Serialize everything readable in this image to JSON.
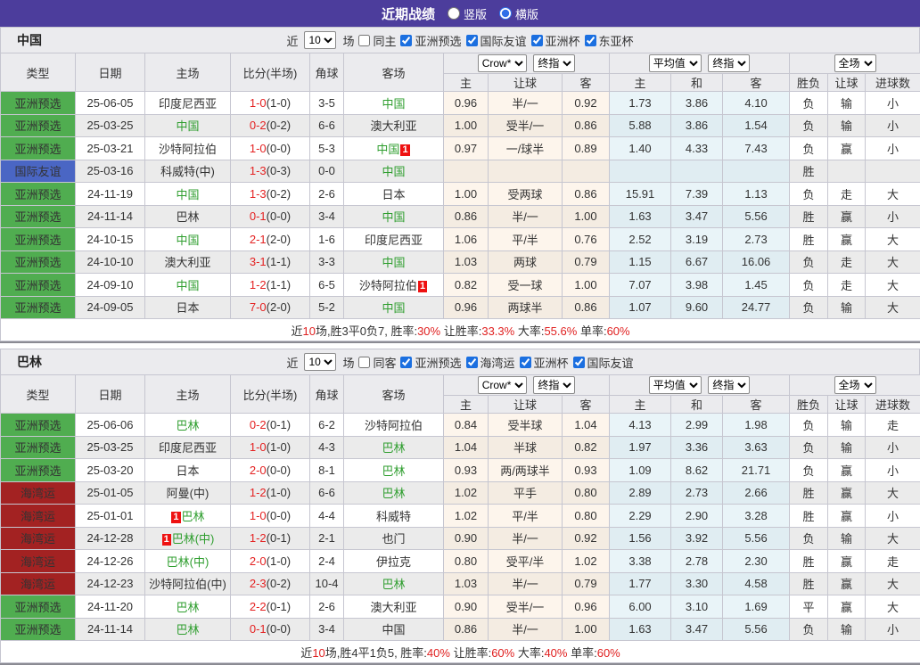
{
  "topbar": {
    "title": "近期战绩",
    "radio_vertical": "竖版",
    "radio_horizontal": "横版",
    "accent_color": "#4c3d9c"
  },
  "headers": {
    "cols": [
      "类型",
      "日期",
      "主场",
      "比分(半场)",
      "角球",
      "客场"
    ],
    "dd": [
      "Crow*",
      "终指",
      "平均值",
      "终指",
      "全场"
    ],
    "sub": [
      "主",
      "让球",
      "客",
      "主",
      "和",
      "客",
      "胜负",
      "让球",
      "进球数"
    ]
  },
  "status_colors": {
    "win": "#e03333",
    "lose": "#2626d9",
    "draw_or_push": "#2e8b2e",
    "type_green": "#50ad50",
    "type_blue": "#4a66c4",
    "type_red": "#a32222",
    "team_highlight": "#2f9e2f",
    "score_red": "#e42222"
  },
  "tables": [
    {
      "team": "中国",
      "filter": {
        "near": "近",
        "count": "10",
        "games": "场",
        "same": "同主",
        "same_checked": false,
        "comps": [
          "亚洲预选",
          "国际友谊",
          "亚洲杯",
          "东亚杯"
        ],
        "comps_checked": [
          true,
          true,
          true,
          true
        ]
      },
      "rows": [
        {
          "type": "亚洲预选",
          "tc": "g",
          "date": "25-06-05",
          "home": "印度尼西亚",
          "hhl": false,
          "hbadge": "",
          "hbpos": "",
          "ft": "1-0",
          "ht": "(1-0)",
          "cor": "3-5",
          "away": "中国",
          "ahl": true,
          "abadge": "",
          "o": [
            "0.96",
            "半/一",
            "0.92"
          ],
          "a": [
            "1.73",
            "3.86",
            "4.10"
          ],
          "r": [
            "负",
            "输",
            "小"
          ]
        },
        {
          "type": "亚洲预选",
          "tc": "g",
          "date": "25-03-25",
          "home": "中国",
          "hhl": true,
          "hbadge": "",
          "hbpos": "",
          "ft": "0-2",
          "ht": "(0-2)",
          "cor": "6-6",
          "away": "澳大利亚",
          "ahl": false,
          "abadge": "",
          "o": [
            "1.00",
            "受半/一",
            "0.86"
          ],
          "a": [
            "5.88",
            "3.86",
            "1.54"
          ],
          "r": [
            "负",
            "输",
            "小"
          ]
        },
        {
          "type": "亚洲预选",
          "tc": "g",
          "date": "25-03-21",
          "home": "沙特阿拉伯",
          "hhl": false,
          "hbadge": "",
          "hbpos": "",
          "ft": "1-0",
          "ht": "(0-0)",
          "cor": "5-3",
          "away": "中国",
          "ahl": true,
          "abadge": "1",
          "o": [
            "0.97",
            "一/球半",
            "0.89"
          ],
          "a": [
            "1.40",
            "4.33",
            "7.43"
          ],
          "r": [
            "负",
            "赢",
            "小"
          ]
        },
        {
          "type": "国际友谊",
          "tc": "b",
          "date": "25-03-16",
          "home": "科威特(中)",
          "hhl": false,
          "hbadge": "",
          "hbpos": "",
          "ft": "1-3",
          "ht": "(0-3)",
          "cor": "0-0",
          "away": "中国",
          "ahl": true,
          "abadge": "",
          "o": [
            "",
            "",
            ""
          ],
          "a": [
            "",
            "",
            ""
          ],
          "r": [
            "胜",
            "",
            ""
          ]
        },
        {
          "type": "亚洲预选",
          "tc": "g",
          "date": "24-11-19",
          "home": "中国",
          "hhl": true,
          "hbadge": "",
          "hbpos": "",
          "ft": "1-3",
          "ht": "(0-2)",
          "cor": "2-6",
          "away": "日本",
          "ahl": false,
          "abadge": "",
          "o": [
            "1.00",
            "受两球",
            "0.86"
          ],
          "a": [
            "15.91",
            "7.39",
            "1.13"
          ],
          "r": [
            "负",
            "走",
            "大"
          ]
        },
        {
          "type": "亚洲预选",
          "tc": "g",
          "date": "24-11-14",
          "home": "巴林",
          "hhl": false,
          "hbadge": "",
          "hbpos": "",
          "ft": "0-1",
          "ht": "(0-0)",
          "cor": "3-4",
          "away": "中国",
          "ahl": true,
          "abadge": "",
          "o": [
            "0.86",
            "半/一",
            "1.00"
          ],
          "a": [
            "1.63",
            "3.47",
            "5.56"
          ],
          "r": [
            "胜",
            "赢",
            "小"
          ]
        },
        {
          "type": "亚洲预选",
          "tc": "g",
          "date": "24-10-15",
          "home": "中国",
          "hhl": true,
          "hbadge": "",
          "hbpos": "",
          "ft": "2-1",
          "ht": "(2-0)",
          "cor": "1-6",
          "away": "印度尼西亚",
          "ahl": false,
          "abadge": "",
          "o": [
            "1.06",
            "平/半",
            "0.76"
          ],
          "a": [
            "2.52",
            "3.19",
            "2.73"
          ],
          "r": [
            "胜",
            "赢",
            "大"
          ]
        },
        {
          "type": "亚洲预选",
          "tc": "g",
          "date": "24-10-10",
          "home": "澳大利亚",
          "hhl": false,
          "hbadge": "",
          "hbpos": "",
          "ft": "3-1",
          "ht": "(1-1)",
          "cor": "3-3",
          "away": "中国",
          "ahl": true,
          "abadge": "",
          "o": [
            "1.03",
            "两球",
            "0.79"
          ],
          "a": [
            "1.15",
            "6.67",
            "16.06"
          ],
          "r": [
            "负",
            "走",
            "大"
          ]
        },
        {
          "type": "亚洲预选",
          "tc": "g",
          "date": "24-09-10",
          "home": "中国",
          "hhl": true,
          "hbadge": "",
          "hbpos": "",
          "ft": "1-2",
          "ht": "(1-1)",
          "cor": "6-5",
          "away": "沙特阿拉伯",
          "ahl": false,
          "abadge": "1",
          "o": [
            "0.82",
            "受一球",
            "1.00"
          ],
          "a": [
            "7.07",
            "3.98",
            "1.45"
          ],
          "r": [
            "负",
            "走",
            "大"
          ]
        },
        {
          "type": "亚洲预选",
          "tc": "g",
          "date": "24-09-05",
          "home": "日本",
          "hhl": false,
          "hbadge": "",
          "hbpos": "",
          "ft": "7-0",
          "ht": "(2-0)",
          "cor": "5-2",
          "away": "中国",
          "ahl": true,
          "abadge": "",
          "o": [
            "0.96",
            "两球半",
            "0.86"
          ],
          "a": [
            "1.07",
            "9.60",
            "24.77"
          ],
          "r": [
            "负",
            "输",
            "大"
          ]
        }
      ],
      "summary": [
        {
          "t": "近",
          "hl": false
        },
        {
          "t": "10",
          "hl": true
        },
        {
          "t": "场,胜3平0负7, 胜率:",
          "hl": false
        },
        {
          "t": "30%",
          "hl": true
        },
        {
          "t": " 让胜率:",
          "hl": false
        },
        {
          "t": "33.3%",
          "hl": true
        },
        {
          "t": " 大率:",
          "hl": false
        },
        {
          "t": "55.6%",
          "hl": true
        },
        {
          "t": " 单率:",
          "hl": false
        },
        {
          "t": "60%",
          "hl": true
        }
      ]
    },
    {
      "team": "巴林",
      "filter": {
        "near": "近",
        "count": "10",
        "games": "场",
        "same": "同客",
        "same_checked": false,
        "comps": [
          "亚洲预选",
          "海湾运",
          "亚洲杯",
          "国际友谊"
        ],
        "comps_checked": [
          true,
          true,
          true,
          true
        ]
      },
      "rows": [
        {
          "type": "亚洲预选",
          "tc": "g",
          "date": "25-06-06",
          "home": "巴林",
          "hhl": true,
          "hbadge": "",
          "hbpos": "",
          "ft": "0-2",
          "ht": "(0-1)",
          "cor": "6-2",
          "away": "沙特阿拉伯",
          "ahl": false,
          "abadge": "",
          "o": [
            "0.84",
            "受半球",
            "1.04"
          ],
          "a": [
            "4.13",
            "2.99",
            "1.98"
          ],
          "r": [
            "负",
            "输",
            "走"
          ]
        },
        {
          "type": "亚洲预选",
          "tc": "g",
          "date": "25-03-25",
          "home": "印度尼西亚",
          "hhl": false,
          "hbadge": "",
          "hbpos": "",
          "ft": "1-0",
          "ht": "(1-0)",
          "cor": "4-3",
          "away": "巴林",
          "ahl": true,
          "abadge": "",
          "o": [
            "1.04",
            "半球",
            "0.82"
          ],
          "a": [
            "1.97",
            "3.36",
            "3.63"
          ],
          "r": [
            "负",
            "输",
            "小"
          ]
        },
        {
          "type": "亚洲预选",
          "tc": "g",
          "date": "25-03-20",
          "home": "日本",
          "hhl": false,
          "hbadge": "",
          "hbpos": "",
          "ft": "2-0",
          "ht": "(0-0)",
          "cor": "8-1",
          "away": "巴林",
          "ahl": true,
          "abadge": "",
          "o": [
            "0.93",
            "两/两球半",
            "0.93"
          ],
          "a": [
            "1.09",
            "8.62",
            "21.71"
          ],
          "r": [
            "负",
            "赢",
            "小"
          ]
        },
        {
          "type": "海湾运",
          "tc": "r",
          "date": "25-01-05",
          "home": "阿曼(中)",
          "hhl": false,
          "hbadge": "",
          "hbpos": "",
          "ft": "1-2",
          "ht": "(1-0)",
          "cor": "6-6",
          "away": "巴林",
          "ahl": true,
          "abadge": "",
          "o": [
            "1.02",
            "平手",
            "0.80"
          ],
          "a": [
            "2.89",
            "2.73",
            "2.66"
          ],
          "r": [
            "胜",
            "赢",
            "大"
          ]
        },
        {
          "type": "海湾运",
          "tc": "r",
          "date": "25-01-01",
          "home": "巴林",
          "hhl": true,
          "hbadge": "1",
          "hbpos": "before",
          "ft": "1-0",
          "ht": "(0-0)",
          "cor": "4-4",
          "away": "科威特",
          "ahl": false,
          "abadge": "",
          "o": [
            "1.02",
            "平/半",
            "0.80"
          ],
          "a": [
            "2.29",
            "2.90",
            "3.28"
          ],
          "r": [
            "胜",
            "赢",
            "小"
          ]
        },
        {
          "type": "海湾运",
          "tc": "r",
          "date": "24-12-28",
          "home": "巴林(中)",
          "hhl": true,
          "hbadge": "1",
          "hbpos": "before",
          "ft": "1-2",
          "ht": "(0-1)",
          "cor": "2-1",
          "away": "也门",
          "ahl": false,
          "abadge": "",
          "o": [
            "0.90",
            "半/一",
            "0.92"
          ],
          "a": [
            "1.56",
            "3.92",
            "5.56"
          ],
          "r": [
            "负",
            "输",
            "大"
          ]
        },
        {
          "type": "海湾运",
          "tc": "r",
          "date": "24-12-26",
          "home": "巴林(中)",
          "hhl": true,
          "hbadge": "",
          "hbpos": "",
          "ft": "2-0",
          "ht": "(1-0)",
          "cor": "2-4",
          "away": "伊拉克",
          "ahl": false,
          "abadge": "",
          "o": [
            "0.80",
            "受平/半",
            "1.02"
          ],
          "a": [
            "3.38",
            "2.78",
            "2.30"
          ],
          "r": [
            "胜",
            "赢",
            "走"
          ]
        },
        {
          "type": "海湾运",
          "tc": "r",
          "date": "24-12-23",
          "home": "沙特阿拉伯(中)",
          "hhl": false,
          "hbadge": "",
          "hbpos": "",
          "ft": "2-3",
          "ht": "(0-2)",
          "cor": "10-4",
          "away": "巴林",
          "ahl": true,
          "abadge": "",
          "o": [
            "1.03",
            "半/一",
            "0.79"
          ],
          "a": [
            "1.77",
            "3.30",
            "4.58"
          ],
          "r": [
            "胜",
            "赢",
            "大"
          ]
        },
        {
          "type": "亚洲预选",
          "tc": "g",
          "date": "24-11-20",
          "home": "巴林",
          "hhl": true,
          "hbadge": "",
          "hbpos": "",
          "ft": "2-2",
          "ht": "(0-1)",
          "cor": "2-6",
          "away": "澳大利亚",
          "ahl": false,
          "abadge": "",
          "o": [
            "0.90",
            "受半/一",
            "0.96"
          ],
          "a": [
            "6.00",
            "3.10",
            "1.69"
          ],
          "r": [
            "平",
            "赢",
            "大"
          ]
        },
        {
          "type": "亚洲预选",
          "tc": "g",
          "date": "24-11-14",
          "home": "巴林",
          "hhl": true,
          "hbadge": "",
          "hbpos": "",
          "ft": "0-1",
          "ht": "(0-0)",
          "cor": "3-4",
          "away": "中国",
          "ahl": false,
          "abadge": "",
          "o": [
            "0.86",
            "半/一",
            "1.00"
          ],
          "a": [
            "1.63",
            "3.47",
            "5.56"
          ],
          "r": [
            "负",
            "输",
            "小"
          ]
        }
      ],
      "summary": [
        {
          "t": "近",
          "hl": false
        },
        {
          "t": "10",
          "hl": true
        },
        {
          "t": "场,胜4平1负5, 胜率:",
          "hl": false
        },
        {
          "t": "40%",
          "hl": true
        },
        {
          "t": " 让胜率:",
          "hl": false
        },
        {
          "t": "60%",
          "hl": true
        },
        {
          "t": " 大率:",
          "hl": false
        },
        {
          "t": "40%",
          "hl": true
        },
        {
          "t": " 单率:",
          "hl": false
        },
        {
          "t": "60%",
          "hl": true
        }
      ]
    }
  ]
}
